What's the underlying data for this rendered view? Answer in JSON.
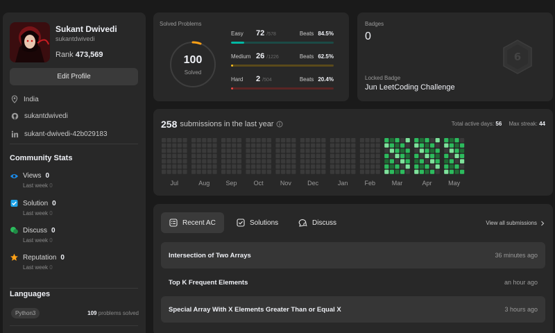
{
  "profile": {
    "name": "Sukant Dwivedi",
    "handle": "sukantdwivedi",
    "rank_label": "Rank",
    "rank_value": "473,569",
    "edit_label": "Edit Profile",
    "location": "India",
    "github": "sukantdwivedi",
    "linkedin": "sukant-dwivedi-42b029183"
  },
  "community": {
    "title": "Community Stats",
    "stats": [
      {
        "label": "Views",
        "value": "0",
        "last_week_label": "Last week",
        "last_week_value": "0",
        "icon": "eye-icon",
        "color": "#1b8ef0"
      },
      {
        "label": "Solution",
        "value": "0",
        "last_week_label": "Last week",
        "last_week_value": "0",
        "icon": "checkbox-icon",
        "color": "#1ea4e9"
      },
      {
        "label": "Discuss",
        "value": "0",
        "last_week_label": "Last week",
        "last_week_value": "0",
        "icon": "chat-icon",
        "color": "#2cbb5d"
      },
      {
        "label": "Reputation",
        "value": "0",
        "last_week_label": "Last week",
        "last_week_value": "0",
        "icon": "star-icon",
        "color": "#ffa116"
      }
    ]
  },
  "languages": {
    "title": "Languages",
    "items": [
      {
        "name": "Python3",
        "count": "109",
        "suffix": "problems solved"
      }
    ]
  },
  "solved": {
    "title": "Solved Problems",
    "total": "100",
    "total_label": "Solved",
    "difficulties": [
      {
        "label": "Easy",
        "solved": "72",
        "total": "/578",
        "beats_label": "Beats",
        "beats": "84.5%",
        "fraction": 0.125,
        "color": "#00b8a3",
        "track": "#1b4a45"
      },
      {
        "label": "Medium",
        "solved": "26",
        "total": "/1226",
        "beats_label": "Beats",
        "beats": "62.5%",
        "fraction": 0.021,
        "color": "#ffc01e",
        "track": "#5a4a1a"
      },
      {
        "label": "Hard",
        "solved": "2",
        "total": "/504",
        "beats_label": "Beats",
        "beats": "20.4%",
        "fraction": 0.004,
        "color": "#ef4743",
        "track": "#5a2524"
      }
    ],
    "colors": {
      "ring_track": "#3e3e3e",
      "ring_accent": "#ffa116"
    }
  },
  "badges": {
    "title": "Badges",
    "count": "0",
    "locked_title": "Locked Badge",
    "locked_name": "Jun LeetCoding Challenge",
    "badge_number": "6"
  },
  "activity": {
    "count": "258",
    "label": "submissions in the last year",
    "active_days_label": "Total active days:",
    "active_days": "56",
    "streak_label": "Max streak:",
    "streak": "44",
    "months": [
      "Jul",
      "Aug",
      "Sep",
      "Oct",
      "Nov",
      "Dec",
      "Jan",
      "Feb",
      "Mar",
      "Apr",
      "May"
    ],
    "colors": {
      "empty": "#3a3a3a",
      "l1": "#1f6b35",
      "l2": "#2cbb5d",
      "l3": "#7ee29b"
    }
  },
  "recent": {
    "tabs": [
      {
        "label": "Recent AC",
        "icon": "list-icon"
      },
      {
        "label": "Solutions",
        "icon": "checkbox-icon"
      },
      {
        "label": "Discuss",
        "icon": "chat-icon"
      }
    ],
    "view_all": "View all submissions",
    "items": [
      {
        "title": "Intersection of Two Arrays",
        "time": "36 minutes ago"
      },
      {
        "title": "Top K Frequent Elements",
        "time": "an hour ago"
      },
      {
        "title": "Special Array With X Elements Greater Than or Equal X",
        "time": "3 hours ago"
      }
    ]
  }
}
